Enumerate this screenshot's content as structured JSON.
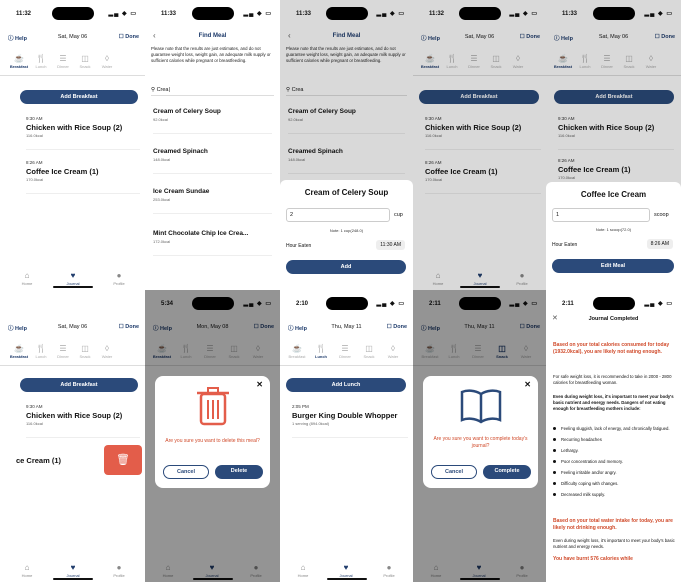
{
  "common": {
    "help": "Help",
    "done": "Done",
    "meal_tabs": [
      "Breakfast",
      "Lunch",
      "Dinner",
      "Snack",
      "Water",
      "Ex"
    ],
    "nav": [
      "Home",
      "Journal",
      "Profile"
    ],
    "add_breakfast": "Add Breakfast",
    "find_meal_title": "Find Meal",
    "disclaimer": "Please note that the results are just estimates, and do not guarantee weight loss, weight gain, an adequate milk supply or sufficient calories while pregnant or breastfeeding.",
    "hour_eaten": "Hour Eaten",
    "cancel": "Cancel"
  },
  "p1": {
    "time": "11:32",
    "date": "Sat, May 06",
    "entries": [
      {
        "time": "9:30 AM",
        "name": "Chicken with Rice Soup (2)",
        "kcal": "116.0kcal"
      },
      {
        "time": "8:26 AM",
        "name": "Coffee Ice Cream (1)",
        "kcal": "170.0kcal"
      }
    ]
  },
  "p2": {
    "time": "11:33",
    "search": "Crea",
    "results": [
      {
        "name": "Cream of Celery Soup",
        "kcal": "92.0kcal"
      },
      {
        "name": "Creamed Spinach",
        "kcal": "148.0kcal"
      },
      {
        "name": "Ice Cream Sundae",
        "kcal": "253.0kcal"
      },
      {
        "name": "Mint Chocolate Chip Ice Crea...",
        "kcal": "172.0kcal"
      }
    ]
  },
  "p3": {
    "time": "11:33",
    "search": "Crea",
    "results": [
      {
        "name": "Cream of Celery Soup",
        "kcal": "92.0kcal"
      },
      {
        "name": "Creamed Spinach",
        "kcal": "148.0kcal"
      }
    ],
    "sheet_title": "Cream of Celery Soup",
    "qty": "2",
    "unit": "cup",
    "note": "Note: 1 cup(248.0)",
    "hour": "11:30 AM",
    "button": "Add"
  },
  "p4": {
    "time": "11:32",
    "date": "Sat, May 06",
    "entries": [
      {
        "time": "9:30 AM",
        "name": "Chicken with Rice Soup (2)",
        "kcal": "116.0kcal"
      },
      {
        "time": "8:26 AM",
        "name": "Coffee Ice Cream (1)",
        "kcal": "170.0kcal"
      }
    ]
  },
  "p5": {
    "time": "11:33",
    "date": "Sat, May 06",
    "entries": [
      {
        "time": "9:30 AM",
        "name": "Chicken with Rice Soup (2)",
        "kcal": "116.0kcal"
      },
      {
        "time": "8:26 AM",
        "name": "Coffee Ice Cream (1)",
        "kcal": "170.0kcal"
      }
    ],
    "sheet_title": "Coffee Ice Cream",
    "qty": "1",
    "unit": "scoop",
    "note": "Note: 1 scoop(72.0)",
    "hour": "8:26 AM",
    "button": "Edit Meal"
  },
  "p6": {
    "date": "Sat, May 06",
    "entries": [
      {
        "time": "9:30 AM",
        "name": "Chicken with Rice Soup (2)",
        "kcal": "116.0kcal"
      },
      {
        "time": "",
        "name": "ce Cream (1)",
        "kcal": ""
      }
    ]
  },
  "p7": {
    "time": "5:34",
    "date": "Mon, May 08",
    "question": "Are you sure you want to delete this meal?",
    "confirm": "Delete"
  },
  "p8": {
    "time": "2:10",
    "date": "Thu, May 11",
    "add": "Add Lunch",
    "entries": [
      {
        "time": "2:05 PM",
        "name": "Burger King Double Whopper",
        "kcal": "1 serving (894.0kcal)"
      }
    ]
  },
  "p9": {
    "time": "2:11",
    "date": "Thu, May 11",
    "question": "Are you sure you want to complete today's journal?",
    "confirm": "Complete"
  },
  "p10": {
    "time": "2:11",
    "title": "Journal Completed",
    "r1": "Based on your total calories consumed for today (1932.0kcal), you are likely not eating enough.",
    "p1": "For safe weight loss, it is recommended to take in 2000 - 2800 calories for breastfeeding woman.",
    "p2": "Even during weight loss, it's important to meet your body's basic nutrient and energy needs. Dangers of not eating enough for breastfeeding mothers include:",
    "bullets": [
      "Feeling sluggish, lack of energy, and chronically fatigued.",
      "Recurring headaches",
      "Lethargy.",
      "Poor concentration and memory.",
      "Feeling irritable and/or angry.",
      "Difficulty coping with changes.",
      "Decreased milk supply."
    ],
    "r2": "Based on your total water intake for today, you are likely not drinking enough.",
    "p3": "Even during weight loss, it's important to meet your body's basic nutrient and energy needs.",
    "r3": "You have burnt 576 calories while"
  }
}
